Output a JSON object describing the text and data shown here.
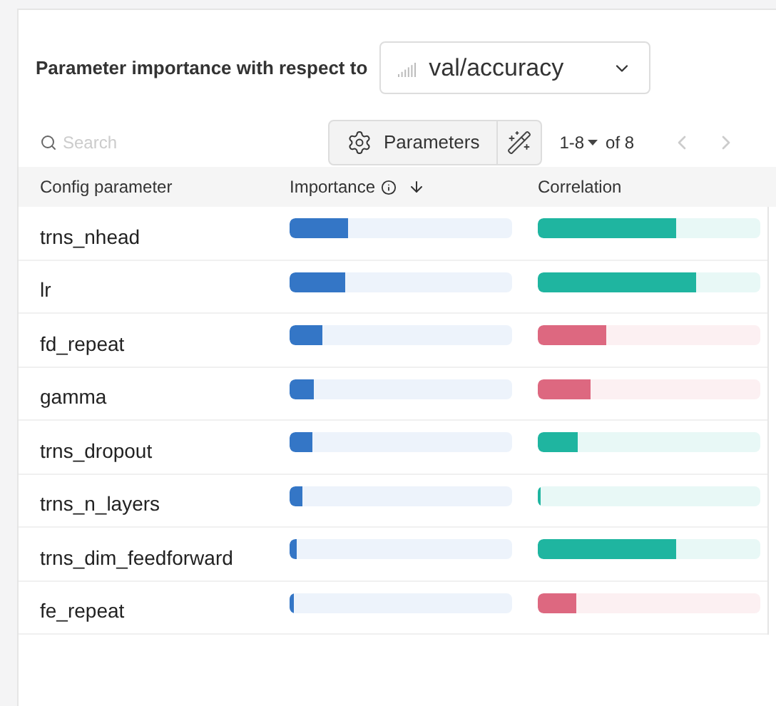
{
  "header": {
    "label": "Parameter importance with respect to",
    "metric": {
      "value": "val/accuracy"
    }
  },
  "toolbar": {
    "search": {
      "placeholder": "Search"
    },
    "parameters_button": "Parameters",
    "pagination": {
      "range": "1-8",
      "total": "of 8"
    }
  },
  "table": {
    "columns": [
      "Config parameter",
      "Importance",
      "Correlation"
    ],
    "rows": [
      {
        "name": "trns_nhead",
        "importance": {
          "level": 0.26
        },
        "correlation": {
          "kind": "positive",
          "level": 0.62
        }
      },
      {
        "name": "lr",
        "importance": {
          "level": 0.25
        },
        "correlation": {
          "kind": "positive",
          "level": 0.71
        }
      },
      {
        "name": "fd_repeat",
        "importance": {
          "level": 0.15
        },
        "correlation": {
          "kind": "negative",
          "level": 0.31
        }
      },
      {
        "name": "gamma",
        "importance": {
          "level": 0.11
        },
        "correlation": {
          "kind": "negative",
          "level": 0.24
        }
      },
      {
        "name": "trns_dropout",
        "importance": {
          "level": 0.1
        },
        "correlation": {
          "kind": "positive",
          "level": 0.18
        }
      },
      {
        "name": "trns_n_layers",
        "importance": {
          "level": 0.06
        },
        "correlation": {
          "kind": "positive",
          "level": 0.015
        }
      },
      {
        "name": "trns_dim_feedforward",
        "importance": {
          "level": 0.03
        },
        "correlation": {
          "kind": "positive",
          "level": 0.62
        }
      },
      {
        "name": "fe_repeat",
        "importance": {
          "level": 0.02
        },
        "correlation": {
          "kind": "negative",
          "level": 0.17
        }
      }
    ]
  }
}
